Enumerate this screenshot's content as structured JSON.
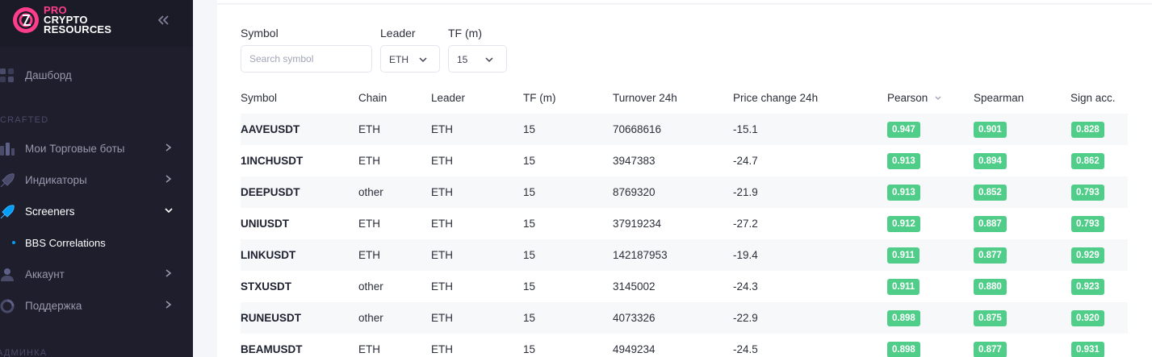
{
  "brand": {
    "line1": "PRO",
    "line2": "CRYPTO",
    "line3": "RESOURCES"
  },
  "sidebar": {
    "dashboard": "Дашборд",
    "section_crafted": "CRAFTED",
    "items": [
      {
        "label": "Мои Торговые боты",
        "icon": "bots-icon"
      },
      {
        "label": "Индикаторы",
        "icon": "rocket-icon"
      },
      {
        "label": "Screeners",
        "icon": "rocket-icon"
      },
      {
        "label": "Аккаунт",
        "icon": "user-icon"
      },
      {
        "label": "Поддержка",
        "icon": "support-icon"
      }
    ],
    "sub_active": "BBS Correlations",
    "section_admin": "АДМИНКА"
  },
  "filters": {
    "symbol_label": "Symbol",
    "symbol_placeholder": "Search symbol",
    "leader_label": "Leader",
    "leader_value": "ETH",
    "tf_label": "TF (m)",
    "tf_value": "15"
  },
  "table": {
    "headers": [
      "Symbol",
      "Chain",
      "Leader",
      "TF (m)",
      "Turnover 24h",
      "Price change 24h",
      "Pearson",
      "Spearman",
      "Sign acc."
    ],
    "sorted_column": "Pearson",
    "rows": [
      {
        "symbol": "AAVEUSDT",
        "chain": "ETH",
        "leader": "ETH",
        "tf": "15",
        "turnover": "70668616",
        "price_change": "-15.1",
        "pearson": "0.947",
        "spearman": "0.901",
        "sign_acc": "0.828"
      },
      {
        "symbol": "1INCHUSDT",
        "chain": "ETH",
        "leader": "ETH",
        "tf": "15",
        "turnover": "3947383",
        "price_change": "-24.7",
        "pearson": "0.913",
        "spearman": "0.894",
        "sign_acc": "0.862"
      },
      {
        "symbol": "DEEPUSDT",
        "chain": "other",
        "leader": "ETH",
        "tf": "15",
        "turnover": "8769320",
        "price_change": "-21.9",
        "pearson": "0.913",
        "spearman": "0.852",
        "sign_acc": "0.793"
      },
      {
        "symbol": "UNIUSDT",
        "chain": "ETH",
        "leader": "ETH",
        "tf": "15",
        "turnover": "37919234",
        "price_change": "-27.2",
        "pearson": "0.912",
        "spearman": "0.887",
        "sign_acc": "0.793"
      },
      {
        "symbol": "LINKUSDT",
        "chain": "ETH",
        "leader": "ETH",
        "tf": "15",
        "turnover": "142187953",
        "price_change": "-19.4",
        "pearson": "0.911",
        "spearman": "0.877",
        "sign_acc": "0.929"
      },
      {
        "symbol": "STXUSDT",
        "chain": "other",
        "leader": "ETH",
        "tf": "15",
        "turnover": "3145002",
        "price_change": "-24.3",
        "pearson": "0.911",
        "spearman": "0.880",
        "sign_acc": "0.923"
      },
      {
        "symbol": "RUNEUSDT",
        "chain": "other",
        "leader": "ETH",
        "tf": "15",
        "turnover": "4073326",
        "price_change": "-22.9",
        "pearson": "0.898",
        "spearman": "0.875",
        "sign_acc": "0.920"
      },
      {
        "symbol": "BEAMUSDT",
        "chain": "ETH",
        "leader": "ETH",
        "tf": "15",
        "turnover": "4949234",
        "price_change": "-24.5",
        "pearson": "0.898",
        "spearman": "0.877",
        "sign_acc": "0.931"
      }
    ]
  },
  "colors": {
    "sidebar_bg": "#1e1e2d",
    "brand_pink": "#ff3d8b",
    "badge_green": "#50cd89",
    "active_dot": "#009ef7"
  }
}
